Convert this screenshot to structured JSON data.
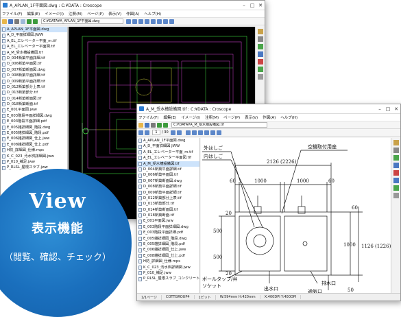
{
  "win1": {
    "title": "A_APLAN_1F平面図.dwg : C:¥DATA : Croscope",
    "menu": [
      "ファイル(F)",
      "編集(E)",
      "イメージ(I)",
      "注釈(M)",
      "ページ(P)",
      "表示(V)",
      "作図(A)",
      "ヘルプ(H)"
    ],
    "path": "C:¥DATA¥A_APLAN_1F平面図.dwg",
    "files": [
      "A_APLAN_1F平面図.dwg",
      "A_D_平面詳細図.JWW",
      "A_EL_エレベーター平面_m.tif",
      "A_EL_エレベーター平面図.tif",
      "A_M_受水槽設備図.tif",
      "D_004新築平面詳細.tif",
      "D_006新築平面図.tif",
      "D_007新築断面図.dwg",
      "D_008新築平面詳細.tif",
      "D_009新築平面詳細.tif",
      "D_012新築部分上表.tif",
      "D_013新築部分.tif",
      "D_014新築断面図.tif",
      "D_018新築断面.tif",
      "E_001平面図.jww",
      "E_003階段平面詳細図.dwg",
      "E_003階段平面詳細.pdf",
      "E_005雑詳細図_階段.dwg",
      "E_005雑詳細図_階段.pdf",
      "E_006雑詳細図_仕上.jww",
      "E_008雑詳細図_仕上.pdf",
      "H防_詳細図_仕様.mps",
      "K_C_023_汚水桝詳細図.jww",
      "P_010_補足.jww",
      "P_RLSL_屋根スラブ.jww"
    ]
  },
  "win2": {
    "title": "A_M_受水槽設備図.tif : C:¥DATA : Croscope",
    "menu": [
      "ファイル(F)",
      "編集(E)",
      "イメージ(I)",
      "注釈(M)",
      "ページ(P)",
      "表示(V)",
      "作図(A)",
      "ヘルプ(H)"
    ],
    "path": "C:¥DATA¥A_M_受水槽設備図.tif",
    "page_current": "1",
    "page_total": "/ 30",
    "files": [
      "A_APLAN_1F平面図.dwg",
      "A_D_平面詳細図.JWW",
      "A_EL_エレベーター平面_m.tif",
      "A_EL_エレベーター平面図.tif",
      "A_M_受水槽設備図.tif",
      "D_004新築平面詳細.tif",
      "D_006新築平面図.tif",
      "D_007新築断面図.dwg",
      "D_008新築平面詳細.tif",
      "D_009新築平面詳細.tif",
      "D_012新築部分上表.tif",
      "D_013新築部分.tif",
      "D_014新築断面図.tif",
      "D_018新築断面.tif",
      "E_001平面図.jww",
      "E_003階段平面詳細図.dwg",
      "E_003階段平面詳細.pdf",
      "E_005雑詳細図_階段.dwg",
      "E_005雑詳細図_階段.pdf",
      "E_006雑詳細図_仕上.jww",
      "E_008雑詳細図_仕上.pdf",
      "H防_詳細図_仕様.mps",
      "K_C_023_汚水桝詳細図.jww",
      "P_010_補足.jww",
      "P_RLSL_屋根スラブ_コンクリート.jww"
    ],
    "status": [
      "1/1ページ",
      "COTTGROUP4",
      "1ビット",
      "W:594mm H:420mm",
      "X:400DPI Y:400DPI"
    ],
    "drawing": {
      "label_top_left_1": "外はしご",
      "label_top_left_2": "内はしご",
      "label_top_right": "空機取付用座",
      "dim_top": "2126 (2226)",
      "dim_60a": "60",
      "dim_60b": "60",
      "dim_1000": "1000",
      "dim_1000b": "1000",
      "dim_500a": "500",
      "dim_500b": "500",
      "dim_1000v": "1000",
      "dim_1126": "1126 (1226)",
      "dim_20a": "20",
      "dim_20b": "20",
      "dim_60c": "60",
      "dim_50": "50",
      "label_bottom_left_1": "ボールタップ/弁",
      "label_bottom_left_2": "ソケット",
      "label_bottom_mid": "出水口",
      "label_bottom_right": "排水口",
      "label_bottom_right2": "通気口"
    }
  },
  "badge": {
    "title": "View",
    "subtitle": "表示機能",
    "caption": "（閲覧、確認、チェック）"
  },
  "colors": {
    "badge": "#1a6fbd",
    "cad_bg": "#000000",
    "cad_line_1": "#d040d0",
    "cad_line_2": "#3fd93f",
    "cad_line_3": "#d6d63a"
  }
}
